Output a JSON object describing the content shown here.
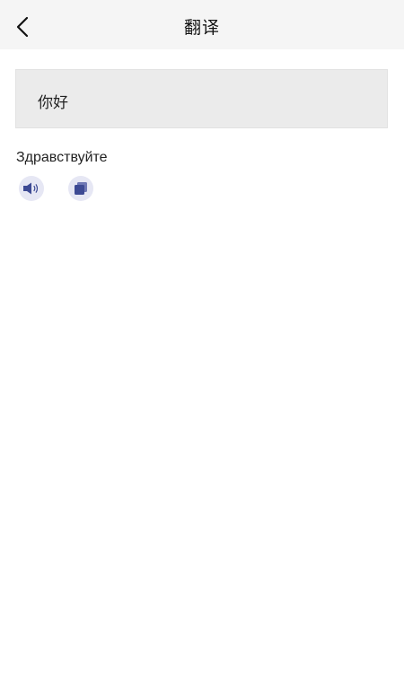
{
  "header": {
    "title": "翻译",
    "back_icon": "chevron-left-icon"
  },
  "source": {
    "text": "你好"
  },
  "result": {
    "text": "Здравствуйте"
  },
  "actions": {
    "speak_icon": "speaker-icon",
    "copy_icon": "copy-icon"
  },
  "colors": {
    "nav_background": "#f5f5f5",
    "source_background": "#ebebeb",
    "icon_accent": "#3d4a94",
    "icon_circle": "#e6e7f4"
  }
}
